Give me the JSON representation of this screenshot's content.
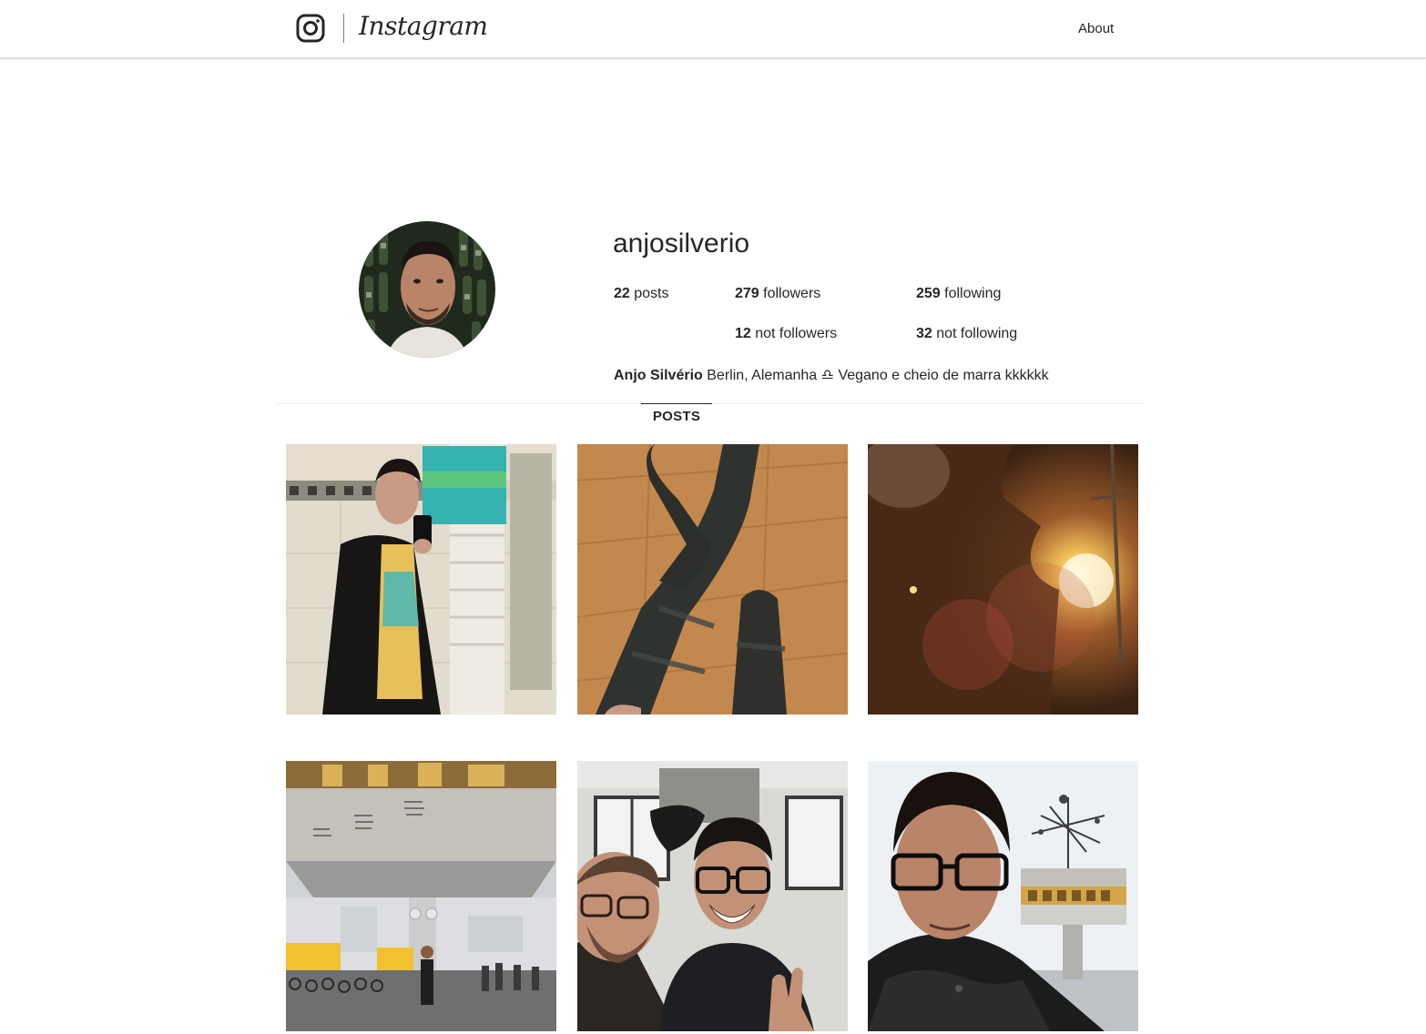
{
  "header": {
    "logo_icon": "instagram-camera-icon",
    "wordmark": "Instagram",
    "about_label": "About"
  },
  "profile": {
    "username": "anjosilverio",
    "stats": {
      "posts_count": "22",
      "posts_label": " posts",
      "followers_count": "279",
      "followers_label": " followers",
      "following_count": "259",
      "following_label": " following",
      "not_followers_count": "12",
      "not_followers_label": " not followers",
      "not_following_count": "32",
      "not_following_label": " not following"
    },
    "bio": {
      "name": "Anjo Silvério",
      "text": " Berlin, Alemanha ♎ Vegano e cheio de marra kkkkkk"
    }
  },
  "tabs": {
    "posts_label": "POSTS"
  },
  "posts": [
    {
      "subject": "mirror-selfie-bathroom"
    },
    {
      "subject": "socks-on-wooden-floor"
    },
    {
      "subject": "sunset-flare-street"
    },
    {
      "subject": "world-clock-alexanderplatz"
    },
    {
      "subject": "selfie-two-friends"
    },
    {
      "subject": "selfie-with-world-clock"
    }
  ],
  "colors": {
    "text": "#262626",
    "border": "#dbdbdb"
  }
}
